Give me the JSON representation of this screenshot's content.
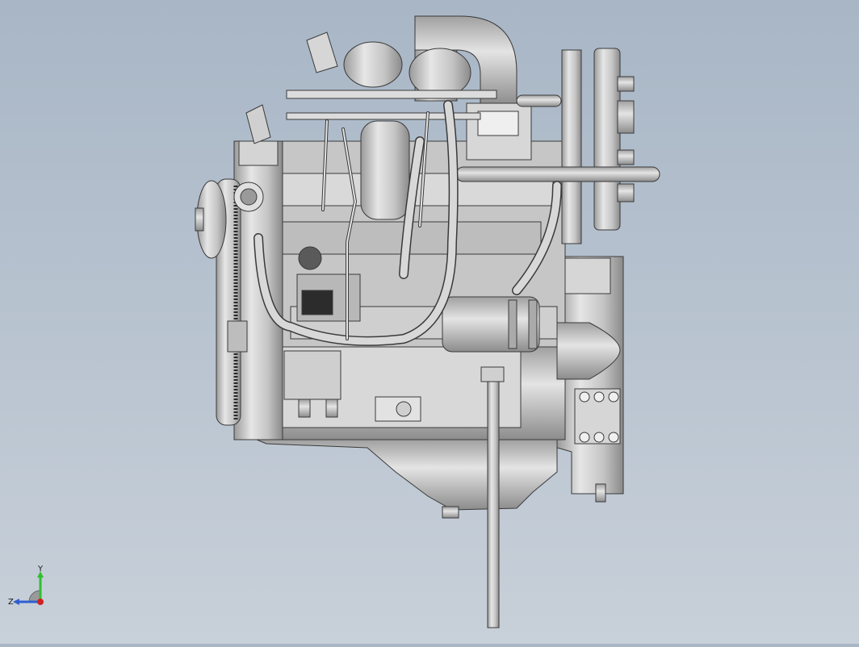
{
  "viewport": {
    "background_top": "#a8b6c6",
    "background_bottom": "#c8d0d9",
    "model_fill": "#c9c9c9",
    "model_stroke": "#3a3a3a",
    "model_shadow": "#8e8e8e"
  },
  "triad": {
    "x_label": "",
    "y_label": "Y",
    "z_label": "Z",
    "y_color": "#2fbf2f",
    "z_color": "#2f5fd0",
    "origin_color": "#d02020"
  }
}
